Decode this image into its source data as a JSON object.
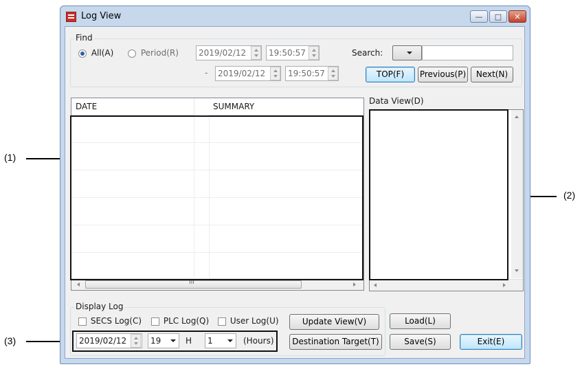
{
  "window": {
    "title": "Log View",
    "controls": {
      "minimize": "—",
      "maximize": "□",
      "close": "✕"
    }
  },
  "find": {
    "group_label": "Find",
    "all_label": "All(A)",
    "all_selected": true,
    "period_label": "Period(R)",
    "period_selected": false,
    "from_date": "2019/02/12",
    "from_time": "19:50:57",
    "dash": "-",
    "to_date": "2019/02/12",
    "to_time": "19:50:57",
    "search_label": "Search:",
    "search_value": "",
    "top_button": "TOP(F)",
    "previous_button": "Previous(P)",
    "next_button": "Next(N)"
  },
  "log_table": {
    "columns": [
      "DATE",
      "SUMMARY"
    ],
    "rows": []
  },
  "data_view": {
    "label": "Data View(D)"
  },
  "display_log": {
    "group_label": "Display Log",
    "secs_label": "SECS Log(C)",
    "secs_checked": false,
    "plc_label": "PLC Log(Q)",
    "plc_checked": false,
    "user_label": "User Log(U)",
    "user_checked": false,
    "date": "2019/02/12",
    "hour": "19",
    "hour_unit": "H",
    "range": "1",
    "range_unit": "(Hours)",
    "update_button": "Update View(V)",
    "destination_button": "Destination Target(T)"
  },
  "buttons": {
    "load": "Load(L)",
    "save": "Save(S)",
    "exit": "Exit(E)"
  },
  "callouts": [
    "(1)",
    "(2)",
    "(3)"
  ],
  "scroll_glyph": "III"
}
